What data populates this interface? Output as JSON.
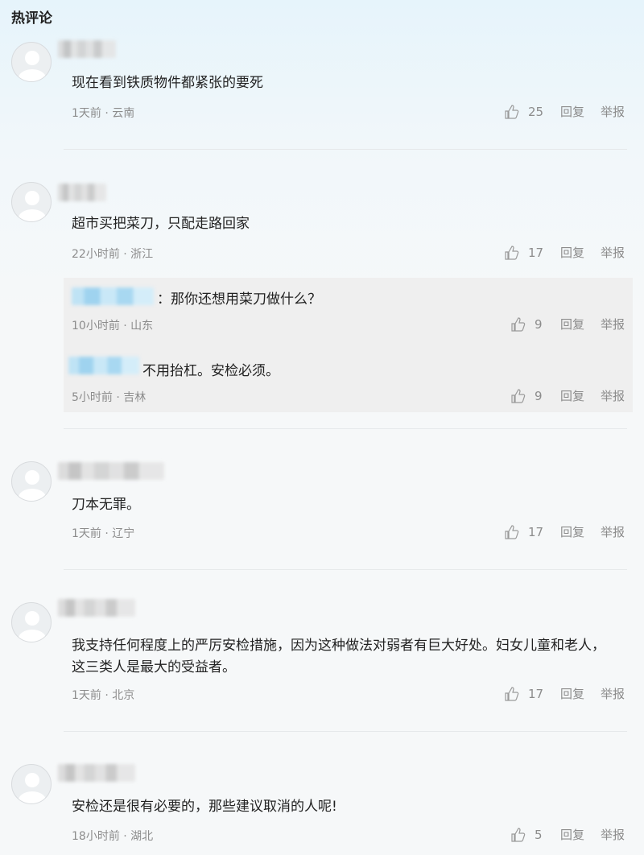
{
  "section_title": "热评论",
  "icons": {
    "like": "thumbs-up-icon",
    "avatar": "default-avatar-icon"
  },
  "colors": {
    "reply_bg": "#efefef",
    "meta": "#8c8c8c",
    "username_blur_reply": "#a8d8f1"
  },
  "labels": {
    "reply": "回复",
    "report": "举报"
  },
  "comments": [
    {
      "text": "现在看到铁质物件都紧张的要死",
      "meta": "1天前 · 云南",
      "likes": "25"
    },
    {
      "text": "超市买把菜刀，只配走路回家",
      "meta": "22小时前 · 浙江",
      "likes": "17",
      "replies": [
        {
          "text": "：那你还想用菜刀做什么？",
          "meta": "10小时前 · 山东",
          "likes": "9"
        },
        {
          "text": "不用抬杠。安检必须。",
          "meta": "5小时前 · 吉林",
          "likes": "9"
        }
      ]
    },
    {
      "text": "刀本无罪。",
      "meta": "1天前 · 辽宁",
      "likes": "17"
    },
    {
      "text_line1": "我支持任何程度上的严厉安检措施，因为这种做法对弱者有巨大好处。妇女儿童和老人，",
      "text_line2": "这三类人是最大的受益者。",
      "meta": "1天前 · 北京",
      "likes": "17"
    },
    {
      "text": "安检还是很有必要的，那些建议取消的人呢!",
      "meta": "18小时前 · 湖北",
      "likes": "5"
    }
  ]
}
